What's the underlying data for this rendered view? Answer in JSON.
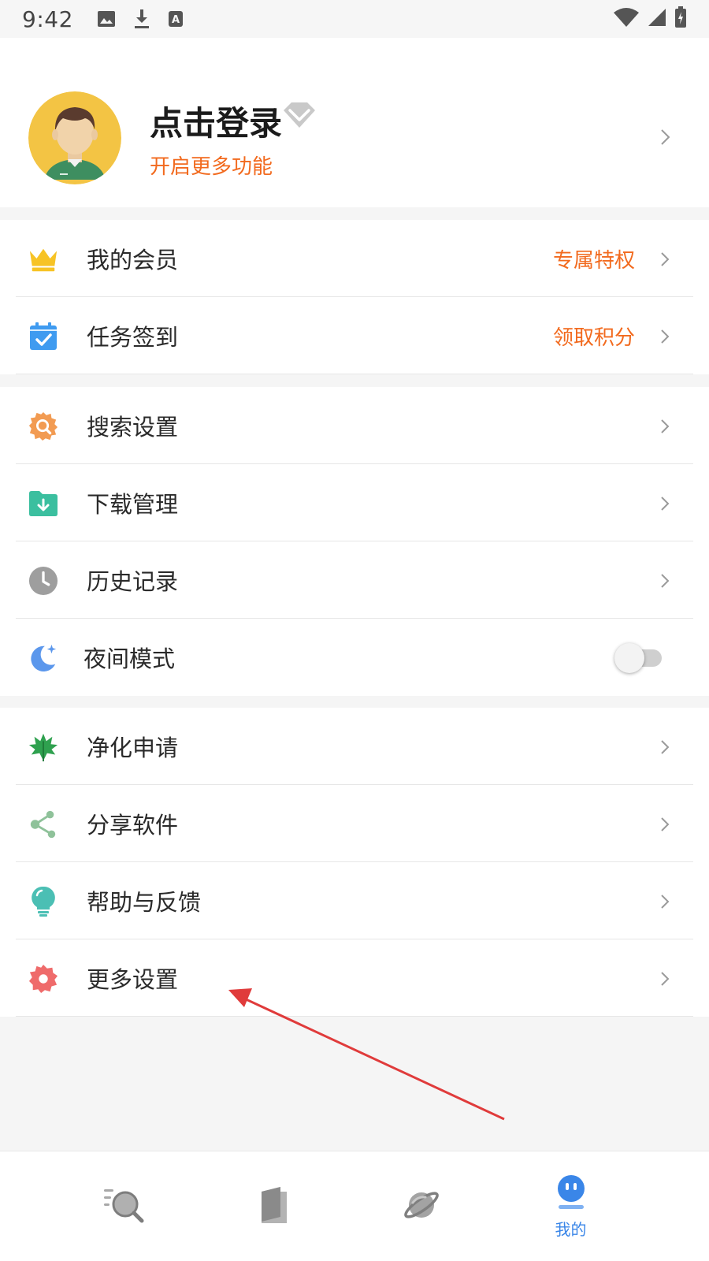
{
  "status_bar": {
    "time": "9:42"
  },
  "profile": {
    "title": "点击登录",
    "subtitle": "开启更多功能"
  },
  "group1": [
    {
      "label": "我的会员",
      "extra": "专属特权",
      "icon": "crown-icon"
    },
    {
      "label": "任务签到",
      "extra": "领取积分",
      "icon": "calendar-check-icon"
    }
  ],
  "group2": [
    {
      "label": "搜索设置",
      "icon": "search-gear-icon"
    },
    {
      "label": "下载管理",
      "icon": "download-folder-icon"
    },
    {
      "label": "历史记录",
      "icon": "clock-icon"
    },
    {
      "label": "夜间模式",
      "icon": "moon-icon",
      "toggle_on": false
    }
  ],
  "group3": [
    {
      "label": "净化申请",
      "icon": "leaf-icon"
    },
    {
      "label": "分享软件",
      "icon": "share-icon"
    },
    {
      "label": "帮助与反馈",
      "icon": "lightbulb-icon"
    },
    {
      "label": "更多设置",
      "icon": "gear-icon"
    }
  ],
  "tabbar": {
    "active_label": "我的",
    "tabs": [
      "search-tab",
      "bookshelf-tab",
      "discover-tab",
      "mine-tab"
    ]
  },
  "colors": {
    "accent_orange": "#f26a1e",
    "active_blue": "#3a86e8",
    "annotation_red": "#e03b3b"
  }
}
